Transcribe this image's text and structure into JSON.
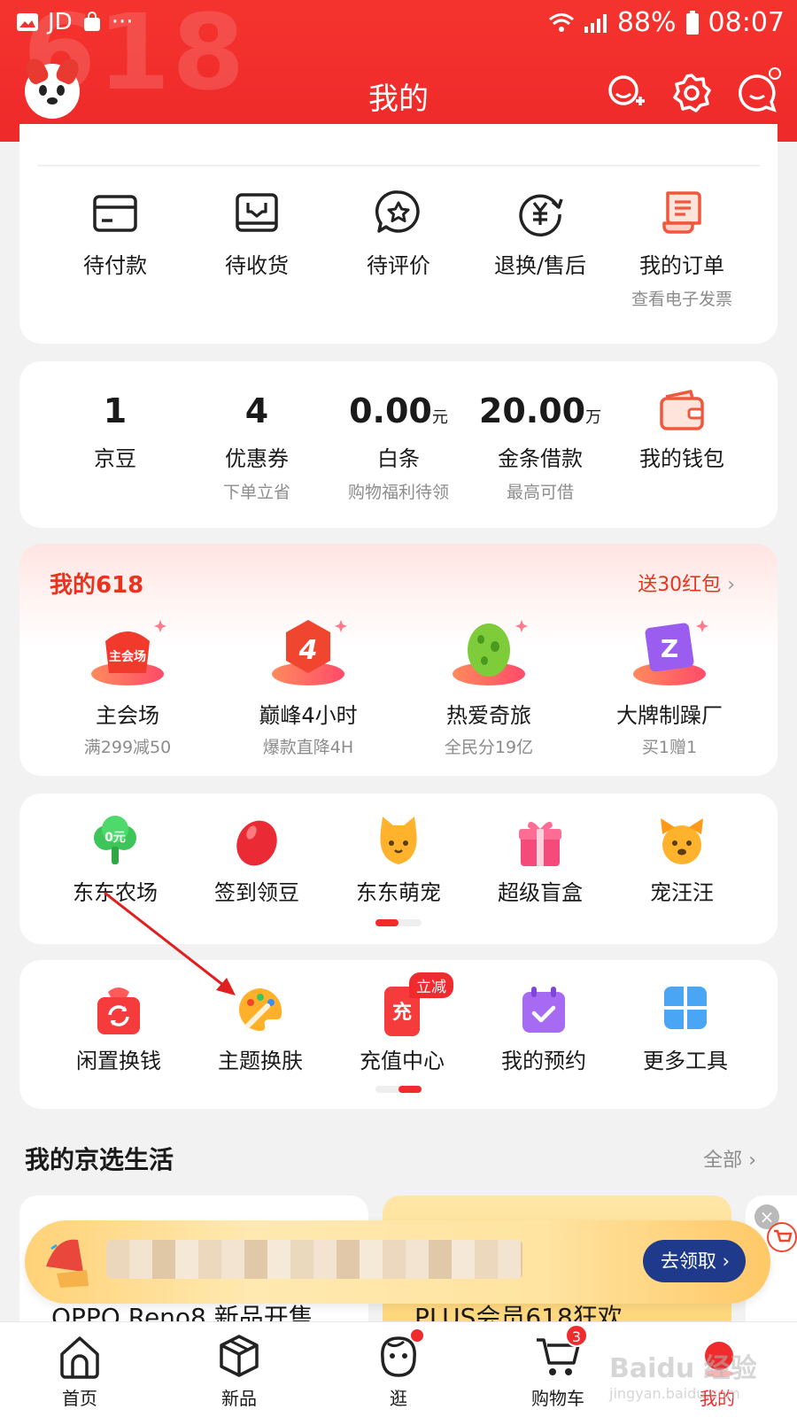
{
  "status_bar": {
    "app": "JD",
    "battery": "88%",
    "time": "08:07"
  },
  "header": {
    "title": "我的",
    "decor_text": "618"
  },
  "orders": [
    {
      "label": "待付款",
      "icon": "wallet-card-icon"
    },
    {
      "label": "待收货",
      "icon": "package-icon"
    },
    {
      "label": "待评价",
      "icon": "review-star-icon"
    },
    {
      "label": "退换/售后",
      "icon": "refund-yen-icon"
    },
    {
      "label": "我的订单",
      "sub": "查看电子发票",
      "icon": "receipt-icon"
    }
  ],
  "assets": [
    {
      "value": "1",
      "label": "京豆"
    },
    {
      "value": "4",
      "label": "优惠券",
      "sub": "下单立省"
    },
    {
      "value": "0.00",
      "unit": "元",
      "label": "白条",
      "sub": "购物福利待领"
    },
    {
      "value": "20.00",
      "unit": "万",
      "label": "金条借款",
      "sub": "最高可借"
    },
    {
      "label": "我的钱包",
      "icon": "wallet-icon"
    }
  ],
  "my618": {
    "title": "我的618",
    "more": "送30红包",
    "items": [
      {
        "label": "主会场",
        "sub": "满299减50",
        "icon_text": "主会场"
      },
      {
        "label": "巅峰4小时",
        "sub": "爆款直降4H",
        "icon_text": "4"
      },
      {
        "label": "热爱奇旅",
        "sub": "全民分19亿"
      },
      {
        "label": "大牌制躁厂",
        "sub": "买1赠1",
        "icon_text": "Z"
      }
    ]
  },
  "games": {
    "items": [
      {
        "label": "东东农场",
        "icon_text": "0元"
      },
      {
        "label": "签到领豆"
      },
      {
        "label": "东东萌宠"
      },
      {
        "label": "超级盲盒"
      },
      {
        "label": "宠汪汪"
      }
    ],
    "page_index": 0
  },
  "tools": {
    "items": [
      {
        "label": "闲置换钱"
      },
      {
        "label": "主题换肤"
      },
      {
        "label": "充值中心",
        "badge": "立减",
        "icon_text": "充"
      },
      {
        "label": "我的预约"
      },
      {
        "label": "更多工具"
      }
    ],
    "page_index": 1
  },
  "life": {
    "title": "我的京选生活",
    "all": "全部",
    "card1_text": "OPPO Reno8 新品开售",
    "card2_text": "PLUS会员618狂欢"
  },
  "coupon_bar": {
    "button": "去领取"
  },
  "tabbar": [
    {
      "label": "首页",
      "icon": "home-icon"
    },
    {
      "label": "新品",
      "icon": "cube-icon"
    },
    {
      "label": "逛",
      "icon": "face-icon",
      "dot": true
    },
    {
      "label": "购物车",
      "icon": "cart-icon",
      "count": "3"
    },
    {
      "label": "我的",
      "icon": "me-icon",
      "active": true
    }
  ],
  "watermark": {
    "main": "Baidu 经验",
    "sub": "jingyan.baidu.com"
  },
  "colors": {
    "brand_red": "#ef2b2d",
    "header_red": "#f5332e",
    "claim_blue": "#1f3a8a"
  }
}
